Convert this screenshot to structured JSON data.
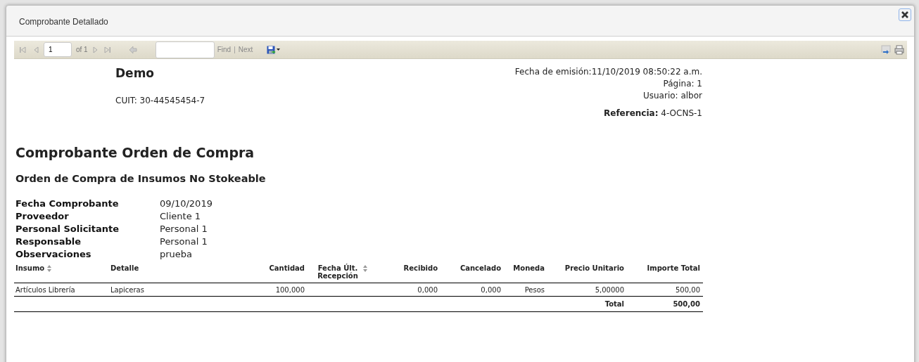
{
  "window": {
    "title": "Comprobante Detallado"
  },
  "toolbar": {
    "page": "1",
    "page_count": "of 1",
    "find": "Find",
    "separator": "|",
    "next": "Next"
  },
  "report": {
    "company": "Demo",
    "tax_id": "CUIT: 30-44545454-7",
    "issue_date": "Fecha de emisión:11/10/2019 08:50:22 a.m.",
    "page": "Página: 1",
    "user": "Usuario: albor",
    "reference_label": "Referencia:",
    "reference": "4-OCNS-1",
    "title": "Comprobante Orden de Compra",
    "subtitle": "Orden de Compra de Insumos No Stokeable",
    "fields": [
      {
        "label": "Fecha Comprobante",
        "value": "09/10/2019"
      },
      {
        "label": "Proveedor",
        "value": "Cliente 1"
      },
      {
        "label": "Personal Solicitante",
        "value": "Personal 1"
      },
      {
        "label": "Responsable",
        "value": "Personal 1"
      },
      {
        "label": "Observaciones",
        "value": "prueba"
      }
    ],
    "table": {
      "columns": [
        {
          "label": "Insumo",
          "sortable": true
        },
        {
          "label": "Detalle",
          "sortable": false
        },
        {
          "label": "Cantidad",
          "sortable": false
        },
        {
          "label": "Fecha Últ. Recepción",
          "sortable": true
        },
        {
          "label": "Recibido",
          "sortable": false
        },
        {
          "label": "Cancelado",
          "sortable": false
        },
        {
          "label": "Moneda",
          "sortable": false
        },
        {
          "label": "Precio Unitario",
          "sortable": false
        },
        {
          "label": "Importe Total",
          "sortable": false
        }
      ],
      "rows": [
        [
          "Artículos Librería",
          "Lapiceras",
          "100,000",
          "",
          "0,000",
          "0,000",
          "Pesos",
          "5,00000",
          "500,00"
        ]
      ],
      "total_label": "Total",
      "total": "500,00"
    }
  }
}
